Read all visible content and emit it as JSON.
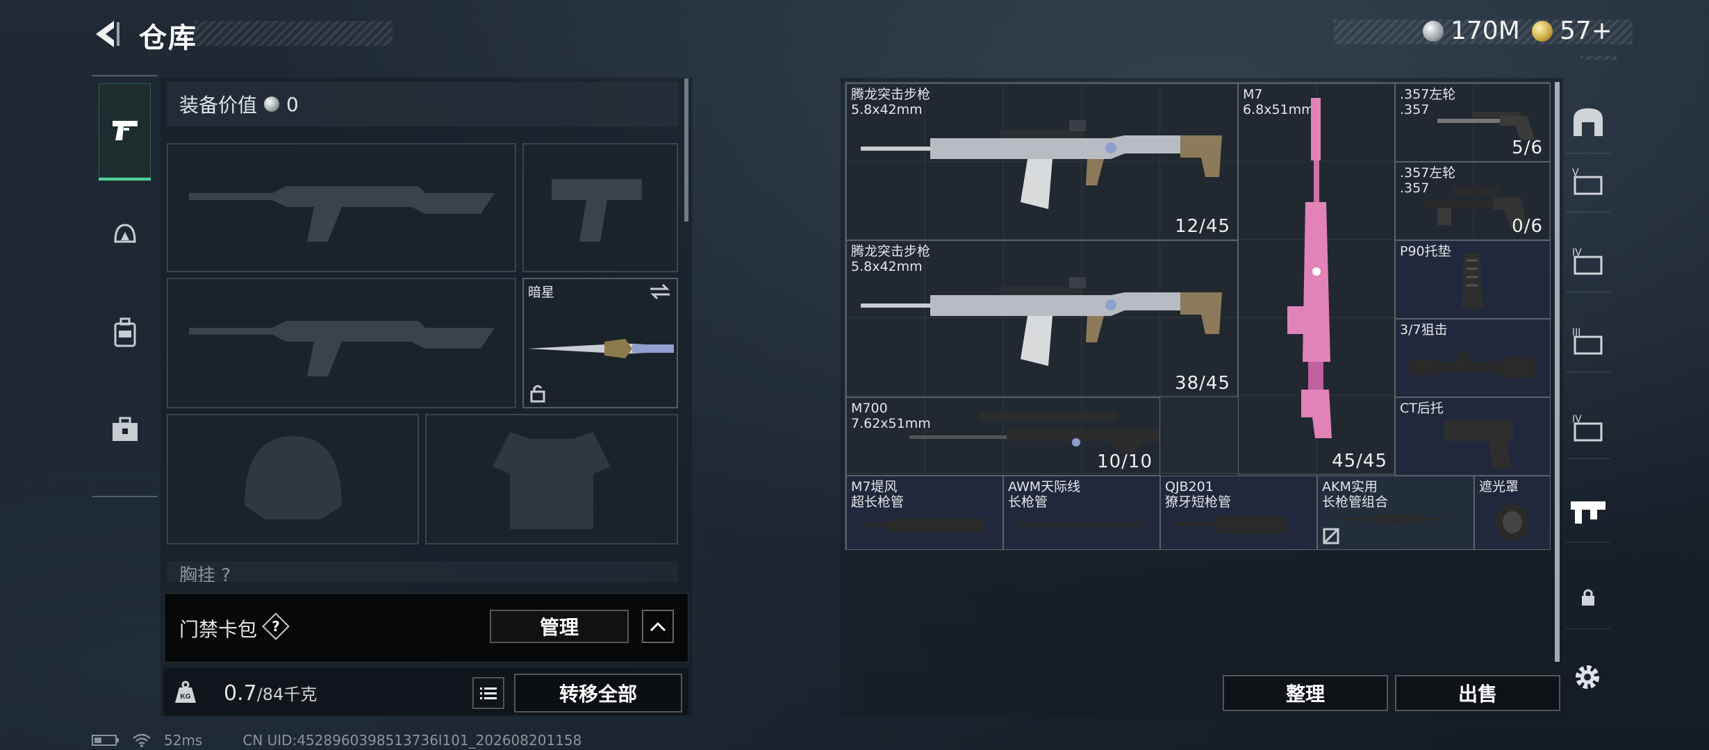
{
  "header": {
    "title": "仓库",
    "currency_silver": "170M",
    "currency_gold": "57+"
  },
  "left_nav": [
    "weapon-icon",
    "backpack-icon",
    "vest-icon",
    "toolbox-icon"
  ],
  "equipment": {
    "value_label": "装备价值",
    "value": "0",
    "melee_name": "暗星",
    "chest_label": "胸挂",
    "chest_help": "?"
  },
  "card_pack": {
    "label": "门禁卡包",
    "help": "?",
    "manage": "管理"
  },
  "capacity": {
    "current": "0.7",
    "max": "/84千克",
    "transfer_all": "转移全部"
  },
  "storage": {
    "items": [
      {
        "name": "腾龙突击步枪\n5.8x42mm",
        "count": "12/45"
      },
      {
        "name": "M7\n6.8x51mm",
        "count": "45/45"
      },
      {
        "name": ".357左轮\n.357",
        "count": "5/6"
      },
      {
        "name": ".357左轮\n.357",
        "count": "0/6"
      },
      {
        "name": "腾龙突击步枪\n5.8x42mm",
        "count": "38/45"
      },
      {
        "name": "P90托垫",
        "count": ""
      },
      {
        "name": "3/7狙击",
        "count": ""
      },
      {
        "name": "M700\n7.62x51mm",
        "count": "10/10"
      },
      {
        "name": "CT后托",
        "count": ""
      },
      {
        "name": "M7堤风\n超长枪管",
        "count": ""
      },
      {
        "name": "AWM天际线\n长枪管",
        "count": ""
      },
      {
        "name": "QJB201\n獠牙短枪管",
        "count": ""
      },
      {
        "name": "AKM实用\n长枪管组合",
        "count": ""
      },
      {
        "name": "遮光罩",
        "count": ""
      }
    ],
    "sort": "整理",
    "sell": "出售"
  },
  "status_bar": {
    "ping": "52ms",
    "uid": "CN UID:4528960398513736l101_202608201158"
  },
  "colors": {
    "accent_green": "#4ecf95",
    "gold": "#c9a640",
    "pink": "#e283b8"
  }
}
